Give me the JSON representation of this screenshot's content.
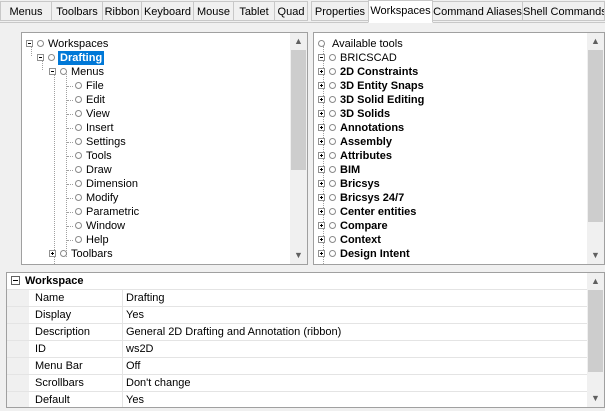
{
  "tabs": [
    "Menus",
    "Toolbars",
    "Ribbon",
    "Keyboard",
    "Mouse",
    "Tablet",
    "Quad",
    "Properties",
    "Workspaces",
    "Command Aliases",
    "Shell Commands"
  ],
  "active_tab": "Workspaces",
  "left_tree": {
    "root": "Workspaces",
    "selected": "Drafting",
    "menus": "Menus",
    "menu_items": [
      "File",
      "Edit",
      "View",
      "Insert",
      "Settings",
      "Tools",
      "Draw",
      "Dimension",
      "Modify",
      "Parametric",
      "Window",
      "Help"
    ],
    "toolbars": "Toolbars"
  },
  "right_tree": {
    "root": "Available tools",
    "group": "BRICSCAD",
    "items": [
      "2D Constraints",
      "3D Entity Snaps",
      "3D Solid Editing",
      "3D Solids",
      "Annotations",
      "Assembly",
      "Attributes",
      "BIM",
      "Bricsys",
      "Bricsys 24/7",
      "Center entities",
      "Compare",
      "Context",
      "Design Intent"
    ]
  },
  "properties": {
    "section": "Workspace",
    "rows": [
      {
        "name": "Name",
        "value": "Drafting"
      },
      {
        "name": "Display",
        "value": "Yes"
      },
      {
        "name": "Description",
        "value": "General 2D Drafting and Annotation (ribbon)"
      },
      {
        "name": "ID",
        "value": "ws2D"
      },
      {
        "name": "Menu Bar",
        "value": "Off"
      },
      {
        "name": "Scrollbars",
        "value": "Don't change"
      },
      {
        "name": "Default",
        "value": "Yes"
      }
    ]
  }
}
